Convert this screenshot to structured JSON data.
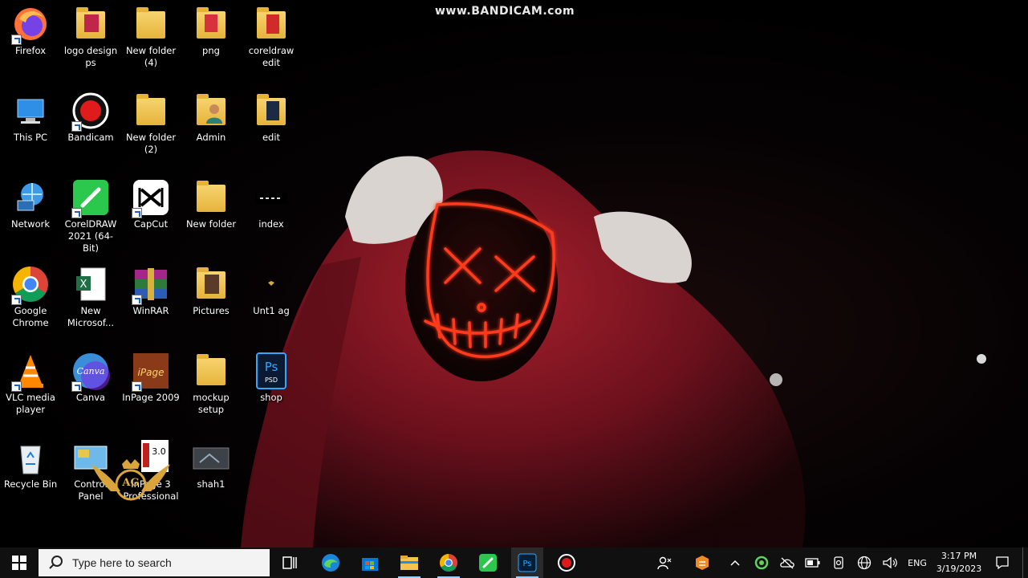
{
  "watermark": "www.BANDICAM.com",
  "desktop": {
    "icons": [
      {
        "label": "Firefox"
      },
      {
        "label": "logo design ps"
      },
      {
        "label": "New folder (4)"
      },
      {
        "label": "png"
      },
      {
        "label": "coreldraw edit"
      },
      {
        "label": "This PC"
      },
      {
        "label": "Bandicam"
      },
      {
        "label": "New folder (2)"
      },
      {
        "label": "Admin"
      },
      {
        "label": "edit"
      },
      {
        "label": "Network"
      },
      {
        "label": "CorelDRAW 2021 (64-Bit)"
      },
      {
        "label": "CapCut"
      },
      {
        "label": "New folder"
      },
      {
        "label": "index"
      },
      {
        "label": "Google Chrome"
      },
      {
        "label": "New Microsof..."
      },
      {
        "label": "WinRAR"
      },
      {
        "label": "Pictures"
      },
      {
        "label": "Unt1 ag"
      },
      {
        "label": "VLC media player"
      },
      {
        "label": "Canva"
      },
      {
        "label": "InPage 2009"
      },
      {
        "label": "mockup setup"
      },
      {
        "label": "shop"
      },
      {
        "label": "Recycle Bin"
      },
      {
        "label": "Control Panel"
      },
      {
        "label": "InPage 3 Professional"
      },
      {
        "label": "shah1"
      }
    ],
    "overlay_logo_text": "AG"
  },
  "taskbar": {
    "search_placeholder": "Type here to search",
    "apps": [
      "task-view",
      "edge",
      "store",
      "file-explorer",
      "chrome",
      "coreldraw",
      "photoshop",
      "bandicam"
    ],
    "tray": {
      "language": "ENG",
      "time": "3:17 PM",
      "date": "3/19/2023"
    }
  },
  "colors": {
    "taskbar_bg": "#101010",
    "neon_red": "#ff3a1e",
    "hoodie_red": "#8e1420"
  }
}
